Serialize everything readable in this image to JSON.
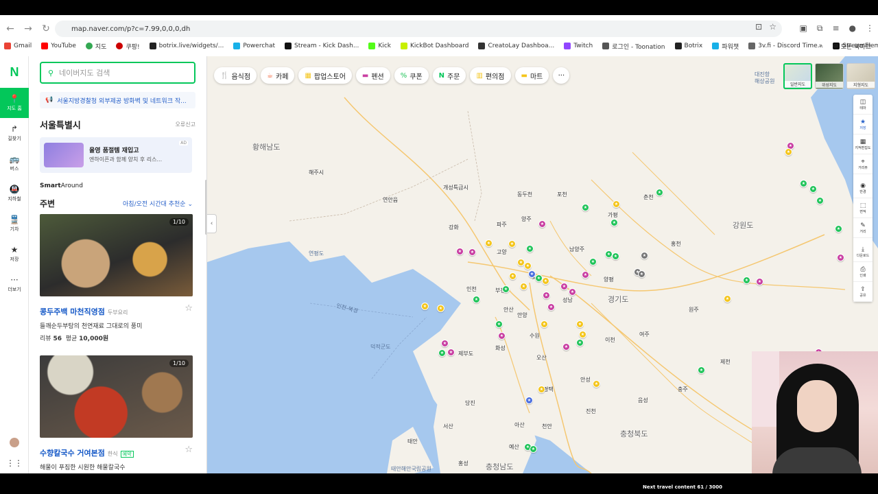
{
  "browser": {
    "url": "map.naver.com/p?c=7.99,0,0,0,dh",
    "bookmarks": [
      "Gmail",
      "YouTube",
      "지도",
      "쿠팡!",
      "botrix.live/widgets/...",
      "Powerchat",
      "Stream - Kick Dash...",
      "Kick",
      "KickBot Dashboard",
      "CreatoLay Dashboa...",
      "Twitch",
      "로그인 - Toonation",
      "Botrix",
      "파워챗",
      "3v.fi - Discord Time...",
      "StreamElements - ..."
    ],
    "bookmarks_more": "»",
    "all_bookmarks": "모든 북마크"
  },
  "leftnav": {
    "logo": "N",
    "items": [
      {
        "label": "지도 홈",
        "icon": "📍"
      },
      {
        "label": "길찾기",
        "icon": "↱"
      },
      {
        "label": "버스",
        "icon": "🚌"
      },
      {
        "label": "지하철",
        "icon": "🚇"
      },
      {
        "label": "기차",
        "icon": "🚆"
      },
      {
        "label": "저장",
        "icon": "★"
      },
      {
        "label": "더보기",
        "icon": "···"
      }
    ]
  },
  "panel": {
    "search_placeholder": "네이버지도 검색",
    "notice": "서울지방경찰청 외부제공 방화벽 및 네트워크 작...",
    "region": "서울특별시",
    "report": "오류신고",
    "ad": {
      "title": "올영 품절템 재입고",
      "sub": "엔하이픈과 함께 양치 후 리스...",
      "tag": "AD"
    },
    "smart_around_a": "Smart",
    "smart_around_b": "Around",
    "nearby": "주변",
    "time_sort": "아침/오전 시간대 추천순 ⌄",
    "cards": [
      {
        "counter": "1/10",
        "name": "콩두주백 마천직영점",
        "category": "두부요리",
        "desc": "들깨순두부탕의 천연재료 그대로의 풍미",
        "review_label": "리뷰",
        "review_count": "56",
        "avg_label": "평균",
        "avg_price": "10,000원"
      },
      {
        "counter": "1/10",
        "name": "수향칼국수 거여본점",
        "category": "한식",
        "badge": "예약",
        "desc": "해물이 푸짐한 시원한 해물칼국수"
      }
    ]
  },
  "map": {
    "categories": [
      {
        "label": "음식점",
        "icon": "🍴",
        "color": "#f28a3c"
      },
      {
        "label": "카페",
        "icon": "☕",
        "color": "#f2653c"
      },
      {
        "label": "팝업스토어",
        "icon": "▦",
        "color": "#f4c51b"
      },
      {
        "label": "펜션",
        "icon": "▬",
        "color": "#c93fa2"
      },
      {
        "label": "쿠폰",
        "icon": "%",
        "color": "#21c45a"
      },
      {
        "label": "주문",
        "icon": "N",
        "color": "#03c75a"
      },
      {
        "label": "편의점",
        "icon": "▥",
        "color": "#f4c51b"
      },
      {
        "label": "마트",
        "icon": "▬",
        "color": "#f4c51b"
      }
    ],
    "more": "···",
    "map_types": [
      "일반지도",
      "위성지도",
      "지형지도"
    ],
    "tools": [
      {
        "label": "테마",
        "icon": "◫"
      },
      {
        "label": "저장",
        "icon": "★"
      },
      {
        "label": "지적편집도",
        "icon": "▦"
      },
      {
        "label": "거리뷰",
        "icon": "⌖"
      },
      {
        "label": "반경",
        "icon": "◉"
      },
      {
        "label": "면적",
        "icon": "⬚"
      },
      {
        "label": "거리",
        "icon": "✎"
      },
      {
        "label": "다운로드",
        "icon": "⤓"
      },
      {
        "label": "인쇄",
        "icon": "⎙"
      },
      {
        "label": "공유",
        "icon": "⇪"
      }
    ],
    "place_labels": [
      {
        "text": "황해남도",
        "size": "big"
      },
      {
        "text": "해주시"
      },
      {
        "text": "연안읍"
      },
      {
        "text": "개성특급시"
      },
      {
        "text": "동두천"
      },
      {
        "text": "포천"
      },
      {
        "text": "양주"
      },
      {
        "text": "가평"
      },
      {
        "text": "춘천"
      },
      {
        "text": "강원도",
        "size": "big"
      },
      {
        "text": "파주"
      },
      {
        "text": "강화"
      },
      {
        "text": "고양"
      },
      {
        "text": "남양주"
      },
      {
        "text": "홍천"
      },
      {
        "text": "연평도",
        "size": "sea"
      },
      {
        "text": "인천"
      },
      {
        "text": "부천"
      },
      {
        "text": "서울"
      },
      {
        "text": "양평"
      },
      {
        "text": "경기도",
        "size": "big"
      },
      {
        "text": "원주"
      },
      {
        "text": "안산"
      },
      {
        "text": "안양"
      },
      {
        "text": "성남"
      },
      {
        "text": "여주"
      },
      {
        "text": "수원"
      },
      {
        "text": "이천"
      },
      {
        "text": "덕적군도",
        "size": "sea"
      },
      {
        "text": "제부도"
      },
      {
        "text": "화성"
      },
      {
        "text": "오산"
      },
      {
        "text": "제천"
      },
      {
        "text": "안성"
      },
      {
        "text": "충주"
      },
      {
        "text": "평택"
      },
      {
        "text": "당진"
      },
      {
        "text": "진천"
      },
      {
        "text": "음성"
      },
      {
        "text": "서산"
      },
      {
        "text": "아산"
      },
      {
        "text": "천안"
      },
      {
        "text": "충청북도",
        "size": "big"
      },
      {
        "text": "태안"
      },
      {
        "text": "예산"
      },
      {
        "text": "홍성"
      },
      {
        "text": "충청남도",
        "size": "big"
      },
      {
        "text": "태안해안국립공원",
        "size": "sea"
      },
      {
        "text": "대진항 해상공원",
        "size": "sea"
      },
      {
        "text": "인천-북경",
        "size": "sea"
      }
    ],
    "pin_colors": {
      "yellow": "#f4c51b",
      "green": "#21c45a",
      "magenta": "#c93fa2",
      "blue": "#4b6fe0",
      "gray": "#777777"
    }
  },
  "overlay": {
    "text": "Next travel content 61 / 3000"
  }
}
